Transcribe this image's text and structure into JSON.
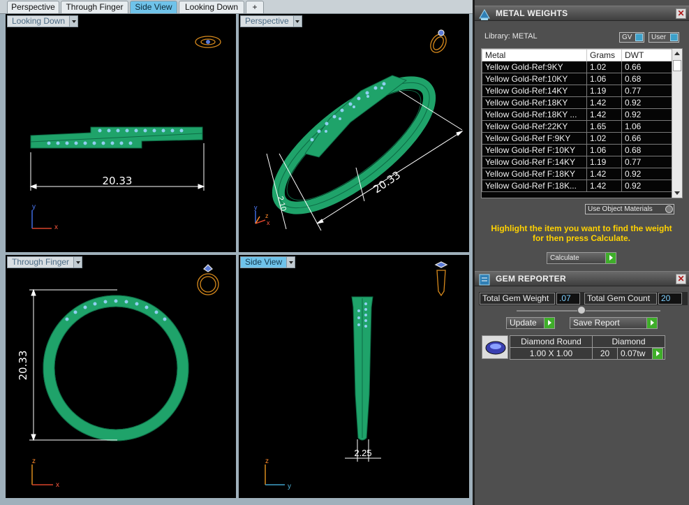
{
  "tabs": [
    "Perspective",
    "Through Finger",
    "Side View",
    "Looking Down",
    "+"
  ],
  "viewports": {
    "looking_down": {
      "label": "Looking Down",
      "dimension": "20.33",
      "axes": [
        "y",
        "x"
      ]
    },
    "perspective": {
      "label": "Perspective",
      "dimension_long": "20.33",
      "dimension_short": "2.10",
      "axes": [
        "y",
        "z",
        "x"
      ]
    },
    "through_finger": {
      "label": "Through Finger",
      "dimension": "20.33",
      "axes": [
        "z",
        "x"
      ]
    },
    "side_view": {
      "label": "Side View",
      "dimension": "2.25",
      "axes": [
        "z",
        "y"
      ]
    }
  },
  "metal_weights": {
    "title": "METAL WEIGHTS",
    "library_label": "Library:",
    "library_value": "METAL",
    "gv_label": "GV",
    "user_label": "User",
    "columns": [
      "Metal",
      "Grams",
      "DWT"
    ],
    "rows": [
      [
        "Yellow Gold-Ref:9KY",
        "1.02",
        "0.66"
      ],
      [
        "Yellow Gold-Ref:10KY",
        "1.06",
        "0.68"
      ],
      [
        "Yellow Gold-Ref:14KY",
        "1.19",
        "0.77"
      ],
      [
        "Yellow Gold-Ref:18KY",
        "1.42",
        "0.92"
      ],
      [
        "Yellow Gold-Ref:18KY ...",
        "1.42",
        "0.92"
      ],
      [
        "Yellow Gold-Ref:22KY",
        "1.65",
        "1.06"
      ],
      [
        "Yellow Gold-Ref F:9KY",
        "1.02",
        "0.66"
      ],
      [
        "Yellow Gold-Ref F:10KY",
        "1.06",
        "0.68"
      ],
      [
        "Yellow Gold-Ref F:14KY",
        "1.19",
        "0.77"
      ],
      [
        "Yellow Gold-Ref F:18KY",
        "1.42",
        "0.92"
      ],
      [
        "Yellow Gold-Ref F:18K...",
        "1.42",
        "0.92"
      ]
    ],
    "use_object_materials": "Use Object Materials",
    "hint": "Highlight the item you want to find the weight for then press Calculate.",
    "calculate_label": "Calculate"
  },
  "gem_reporter": {
    "title": "GEM REPORTER",
    "total_weight_label": "Total Gem Weight",
    "total_weight_value": ".07",
    "total_count_label": "Total Gem Count",
    "total_count_value": "20",
    "update_label": "Update",
    "save_report_label": "Save Report",
    "gem": {
      "shape": "Diamond Round",
      "size": "1.00 X 1.00",
      "material": "Diamond",
      "count": "20",
      "weight": "0.07tw"
    }
  },
  "colors": {
    "ring": "#1fa36a",
    "gem": "#8fd0f0",
    "tab_active": "#6fc3ea",
    "hint": "#ffd200"
  }
}
